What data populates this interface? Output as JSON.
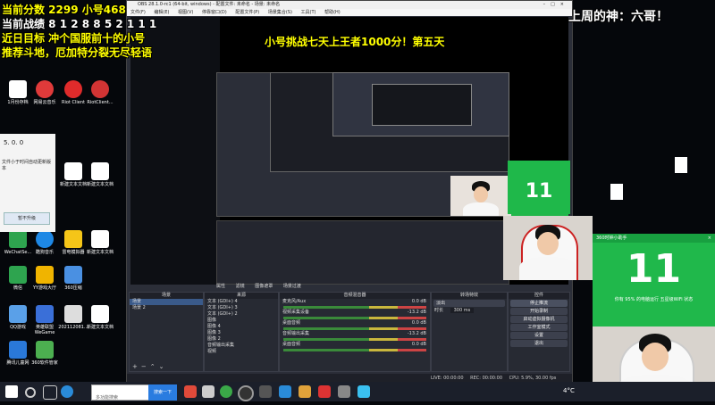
{
  "overlay": {
    "line1": "当前分数 2299  小号468",
    "line2": "当前战绩 8 1 2 8 8 5 2 1 1 1",
    "line3": "近日目标 冲个国服前十的小号",
    "line4": "推荐斗地，厄加特分裂无尽轻语",
    "banner": "小号挑战七天上王者1000分！第五天",
    "top_right": "上周的神：六哥！"
  },
  "obs": {
    "title": "OBS 28.1.0-rc1 (64-bit, windows) - 配置文件: 未命名 - 场景: 未命名",
    "menu": [
      "文件(F)",
      "编辑(E)",
      "视图(V)",
      "停靠窗口(D)",
      "配置文件(P)",
      "场景集合(S)",
      "工具(T)",
      "帮助(H)"
    ],
    "controls": [
      "属性",
      "滤镜",
      "图像遮罩",
      "场景过渡"
    ],
    "scenes_header": "场景",
    "scenes": [
      "场景",
      "场景 2"
    ],
    "sources_header": "来源",
    "sources": [
      "文本 (GDI+) 4",
      "文本 (GDI+) 3",
      "文本 (GDI+) 2",
      "图像",
      "图像 4",
      "图像 3",
      "图像 2",
      "音频输出采集",
      "视频"
    ],
    "mixer_header": "音频混音器",
    "mixer": [
      {
        "name": "麦克风/Aux",
        "level": "0.0 dB"
      },
      {
        "name": "视频采集设备",
        "level": "-13.2 dB"
      },
      {
        "name": "桌面音频",
        "level": "0.0 dB"
      },
      {
        "name": "音频输出采集",
        "level": "-13.2 dB"
      },
      {
        "name": "桌面音频",
        "level": "0.0 dB"
      }
    ],
    "transitions_header": "转场特效",
    "transition_type": "淡出",
    "transition_duration_label": "时长",
    "transition_duration": "300 ms",
    "controls_header": "控件",
    "control_buttons": [
      "停止推流",
      "开始录制",
      "启动虚拟摄像机",
      "工作室模式",
      "设置",
      "退出"
    ],
    "status": {
      "live": "LIVE: 00:00:00",
      "rec": "REC: 00:00:00",
      "cpu": "CPU: 5.9%, 30.00 fps"
    }
  },
  "desktop_icons": [
    {
      "label": "1月份存档",
      "color": "#ffffff"
    },
    {
      "label": "网易云音乐",
      "color": "#e03a3a"
    },
    {
      "label": "Riot Client",
      "color": "#e02b2b"
    },
    {
      "label": "RiotClient...",
      "color": "#d23434"
    },
    {
      "label": "新建文本文档",
      "color": "#ffffff"
    },
    {
      "label": "新建文本文档",
      "color": "#ffffff"
    },
    {
      "label": "WeChatSe...",
      "color": "#2ea44f"
    },
    {
      "label": "酷狗音乐",
      "color": "#1e88e5"
    },
    {
      "label": "雷电模拟器",
      "color": "#f5c518"
    },
    {
      "label": "新建文本文档",
      "color": "#ffffff"
    },
    {
      "label": "微信",
      "color": "#2ea44f"
    },
    {
      "label": "YY游戏大厅",
      "color": "#f0b400"
    },
    {
      "label": "360压缩",
      "color": "#4a90e2"
    },
    {
      "label": "QQ游戏",
      "color": "#5aa0e8"
    },
    {
      "label": "英雄联盟WeGame",
      "color": "#3a6fd8"
    },
    {
      "label": "202112081...",
      "color": "#dddddd"
    },
    {
      "label": "新建文本文档",
      "color": "#ffffff"
    },
    {
      "label": "腾讯儿童网",
      "color": "#2a78d8"
    },
    {
      "label": "360软件管家",
      "color": "#4caf50"
    }
  ],
  "dialog": {
    "text": "5. 0. 0",
    "line": "文件小于时间自动更新版本",
    "button": "暂不升级"
  },
  "timer": {
    "value_large": "11",
    "value_small": "11",
    "header": "360时钟小助手",
    "line": "你有 95% 的电脑运行 五星级WiFi 状态"
  },
  "taskbar": {
    "search_placeholder": "多功能搜索",
    "search_button": "搜索一下",
    "weather": "4°C",
    "time": ""
  },
  "colors": {
    "overlay_text": "#ffff00",
    "banner_text": "#ffff00",
    "top_right_text": "#ffffff",
    "timer_green": "#1fb84a"
  }
}
